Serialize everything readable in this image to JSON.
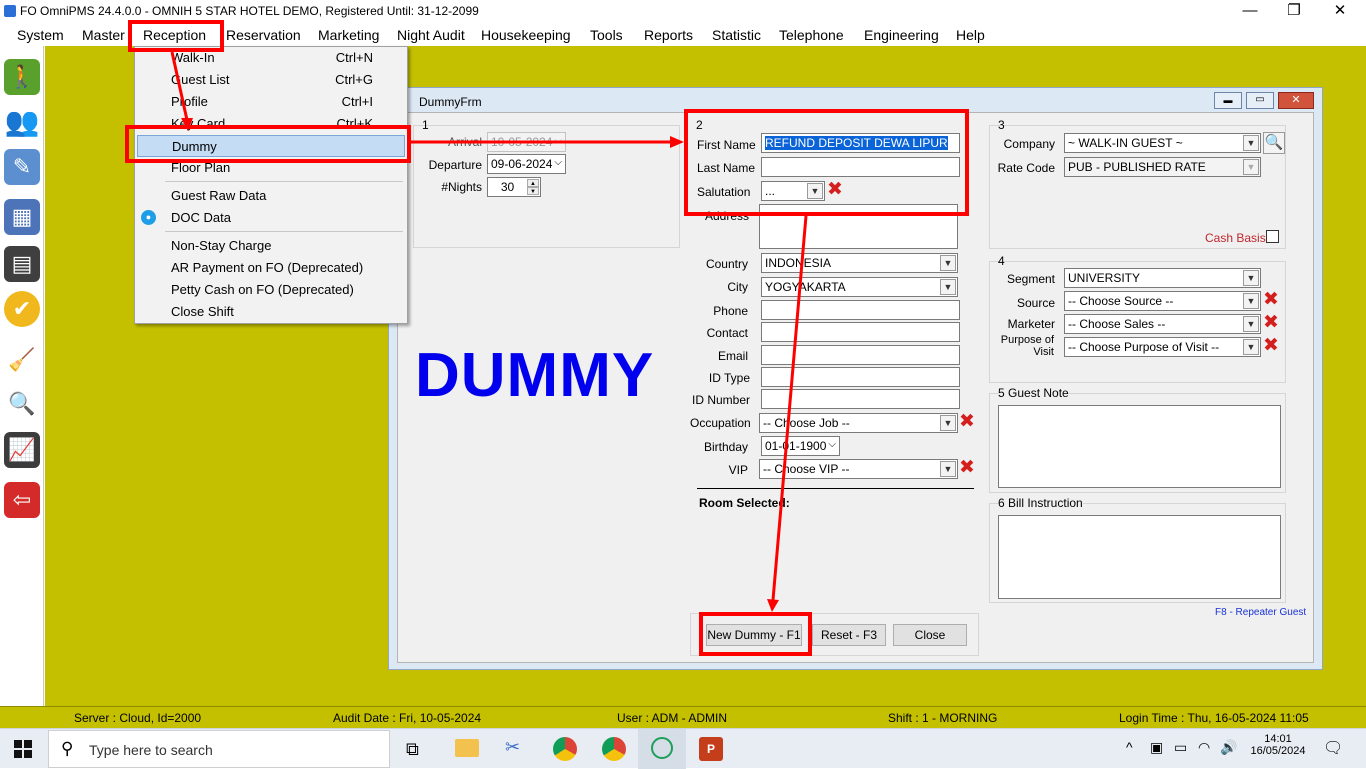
{
  "window": {
    "title": "FO OmniPMS 24.4.0.0 - OMNIH 5 STAR HOTEL DEMO, Registered Until: 31-12-2099",
    "minimize": "—",
    "restore": "❐",
    "close": "✕"
  },
  "menubar": [
    "System",
    "Master",
    "Reception",
    "Reservation",
    "Marketing",
    "Night Audit",
    "Housekeeping",
    "Tools",
    "Reports",
    "Statistic",
    "Telephone",
    "Engineering",
    "Help"
  ],
  "reception_menu": [
    {
      "label": "Walk-In",
      "shortcut": "Ctrl+N"
    },
    {
      "label": "Guest List",
      "shortcut": "Ctrl+G"
    },
    {
      "label": "Profile",
      "shortcut": "Ctrl+I"
    },
    {
      "label": "Key Card",
      "shortcut": "Ctrl+K"
    },
    {
      "label": "Dummy",
      "shortcut": ""
    },
    {
      "label": "Floor Plan",
      "shortcut": ""
    },
    {
      "label": "Guest Raw Data",
      "shortcut": ""
    },
    {
      "label": "DOC Data",
      "shortcut": ""
    },
    {
      "label": "Non-Stay Charge",
      "shortcut": ""
    },
    {
      "label": "AR Payment on FO (Deprecated)",
      "shortcut": ""
    },
    {
      "label": "Petty Cash on FO (Deprecated)",
      "shortcut": ""
    },
    {
      "label": "Close Shift",
      "shortcut": ""
    }
  ],
  "form": {
    "title": "DummyFrm",
    "big_label": "DUMMY",
    "g1": {
      "num": "1",
      "arrival_label": "Arrival",
      "arrival_value": "10-05-2024",
      "departure_label": "Departure",
      "departure_value": "09-06-2024",
      "nights_label": "#Nights",
      "nights_value": "30"
    },
    "g2": {
      "num": "2",
      "first_name_label": "First Name",
      "first_name_value": "REFUND DEPOSIT DEWA LIPUR",
      "last_name_label": "Last Name",
      "last_name_value": "",
      "salutation_label": "Salutation",
      "salutation_value": "...",
      "address_label": "Address",
      "country_label": "Country",
      "country_value": "INDONESIA",
      "city_label": "City",
      "city_value": "YOGYAKARTA",
      "phone_label": "Phone",
      "contact_label": "Contact",
      "email_label": "Email",
      "idtype_label": "ID Type",
      "idnumber_label": "ID Number",
      "occupation_label": "Occupation",
      "occupation_value": "-- Choose Job --",
      "birthday_label": "Birthday",
      "birthday_value": "01-01-1900",
      "vip_label": "VIP",
      "vip_value": "-- Choose VIP --",
      "room_selected_label": "Room Selected:"
    },
    "g3": {
      "num": "3",
      "company_label": "Company",
      "company_value": "~ WALK-IN GUEST ~",
      "ratecode_label": "Rate Code",
      "ratecode_value": "PUB - PUBLISHED RATE",
      "cashbasis_label": "Cash Basis"
    },
    "g4": {
      "num": "4",
      "segment_label": "Segment",
      "segment_value": "UNIVERSITY",
      "source_label": "Source",
      "source_value": "-- Choose Source --",
      "marketer_label": "Marketer",
      "marketer_value": "-- Choose Sales --",
      "purpose_label_1": "Purpose of",
      "purpose_label_2": "Visit",
      "purpose_value": "-- Choose Purpose of Visit --"
    },
    "g5": {
      "title": "5 Guest Note"
    },
    "g6": {
      "title": "6 Bill Instruction"
    },
    "f8_label": "F8 - Repeater Guest",
    "buttons": {
      "new_dummy": "New Dummy - F1",
      "reset": "Reset - F3",
      "close": "Close"
    }
  },
  "statusbar": {
    "server": "Server : Cloud, Id=2000",
    "audit": "Audit Date : Fri, 10-05-2024",
    "user": "User : ADM - ADMIN",
    "shift": "Shift : 1 - MORNING",
    "login": "Login Time : Thu, 16-05-2024 11:05"
  },
  "taskbar": {
    "search_placeholder": "Type here to search",
    "time": "14:01",
    "date": "16/05/2024"
  },
  "colors": {
    "workspace": "#c4c000",
    "highlight_red": "#ff0000",
    "dummy_text": "#0000ee",
    "menu_highlight": "#c5dcf5"
  }
}
